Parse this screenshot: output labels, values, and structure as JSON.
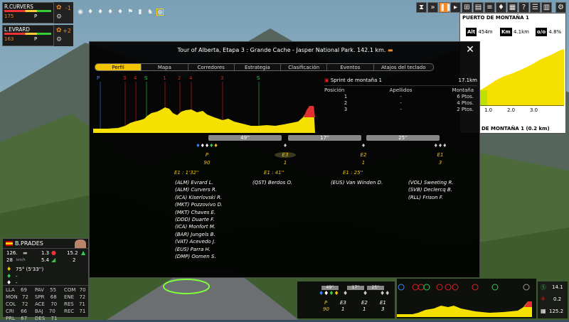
{
  "app": {
    "top_riders": [
      {
        "name": "R.CURVERS",
        "energy": "175",
        "flag": "P",
        "badge": "-1"
      },
      {
        "name": "L.EVRARD",
        "energy": "163",
        "flag": "P",
        "badge": "+2"
      }
    ],
    "toolbar_icons": [
      "camera-icon",
      "jersey-icon",
      "jersey-icon",
      "jersey-icon",
      "jersey-icon",
      "flag-icon",
      "bottle-icon",
      "rider-icon",
      "target-icon"
    ],
    "top_right_icons": [
      "hourglass-icon",
      "sprint-icon",
      "pause-icon",
      "fast-forward-icon",
      "stats-icon",
      "chart-icon",
      "table-icon",
      "jersey-icon",
      "grid-icon",
      "help-icon",
      "gear-icon"
    ]
  },
  "modal": {
    "title": "Tour of Alberta, Etapa 3 : Grande Cache - Jasper National Park. 142.1 km.",
    "tabs": [
      "Perfil",
      "Mapa",
      "Corredores",
      "Estrategia",
      "Clasificación",
      "Eventos",
      "Atajos del teclado"
    ],
    "active_tab": "Perfil",
    "profile_markers": [
      "P",
      "3",
      "4",
      "S",
      "1",
      "2",
      "4",
      "3",
      "S"
    ],
    "sprint": {
      "title": "Sprint de montaña 1",
      "distance": "17.1km",
      "headers": [
        "Posición",
        "Apellidos",
        "Montaña"
      ],
      "rows": [
        {
          "pos": "1",
          "name": "-",
          "pts": "6 Ptos."
        },
        {
          "pos": "2",
          "name": "-",
          "pts": "4 Ptos."
        },
        {
          "pos": "3",
          "name": "-",
          "pts": "2 Ptos."
        }
      ]
    },
    "gaps": [
      "49''",
      "17''",
      "25''"
    ],
    "groups": [
      {
        "label": "P",
        "count": "90",
        "time": "",
        "riders": [
          "(ALM) Evrard L.",
          "(ALM) Curvers R.",
          "(ICA) Kiserlovski R.",
          "(MKT) Pozzovivo D.",
          "(MKT) Chaves E.",
          "(DDD) Duarte F.",
          "(ICA) Monfort M.",
          "(BAR) Jungels B.",
          "(VAT) Acevedo J.",
          "(EUS) Parra H.",
          "(DMP) Oomen S."
        ]
      },
      {
        "label": "E3",
        "count": "1",
        "time": "E1 : 1'32''",
        "riders": [
          "(QST) Berdos O."
        ]
      },
      {
        "label": "E2",
        "count": "1",
        "time": "E1 : 41''",
        "riders": [
          "(EUS) Van Winden D."
        ]
      },
      {
        "label": "E1",
        "count": "3",
        "time": "E1 : 25''",
        "riders": [
          "(VOL) Sweeting R.",
          "(SVB) Declercq B.",
          "(RLL) Frison F."
        ]
      }
    ]
  },
  "rider_panel": {
    "name": "B.PRADES",
    "energy": "126.",
    "speed": "28",
    "speed_unit": "km/h",
    "val1": "1.3",
    "val2": "5.4",
    "val3": "15.2",
    "val4": "2",
    "position": "75° (5'33'')",
    "dash1": "-",
    "dash2": "-",
    "stats": [
      [
        "LLA",
        "69",
        "PAV",
        "55",
        "COM",
        "70"
      ],
      [
        "MON",
        "72",
        "SPR",
        "68",
        "ENE",
        "72"
      ],
      [
        "COL",
        "72",
        "ACE",
        "70",
        "RES",
        "71"
      ],
      [
        "CRI",
        "66",
        "BAJ",
        "70",
        "REC",
        "71"
      ],
      [
        "PRL",
        "67",
        "DES",
        "71",
        "",
        ""
      ]
    ]
  },
  "climb": {
    "title": "PUERTO DE MONTAÑA 1",
    "alt_key": "Alt",
    "alt": "454m",
    "km_key": "Km",
    "km": "4.1km",
    "grade_key": "o/o",
    "grade": "4.8%",
    "axis": [
      "1.0",
      "2.0",
      "3.0"
    ],
    "footer": "DE MONTAÑA 1 (0.2 km)"
  },
  "mini": {
    "gaps": [
      "49''",
      "17''",
      "25''"
    ],
    "labels": [
      "P",
      "E3",
      "E2",
      "E1"
    ],
    "counts": [
      "90",
      "1",
      "1",
      "3"
    ]
  },
  "dist": {
    "d1": "14.1",
    "d2": "0.2",
    "d3": "125.2"
  },
  "colors": {
    "accent": "#f5c400",
    "profile": "#f5e000",
    "sprint": "#dd2222",
    "green": "#33cc55",
    "blue": "#3388ff"
  }
}
